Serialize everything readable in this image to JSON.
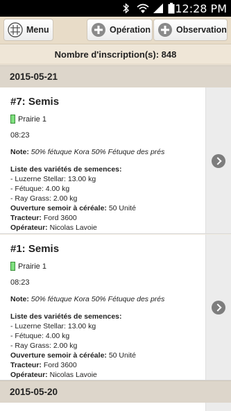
{
  "status_bar": {
    "time": "12:28 PM"
  },
  "toolbar": {
    "menu_label": "Menu",
    "operation_label": "Opération",
    "observation_label": "Observation"
  },
  "summary": {
    "count_text": "Nombre d'inscription(s): 848"
  },
  "groups": [
    {
      "date": "2015-05-21",
      "entries": [
        {
          "title": "#7: Semis",
          "field": "Prairie 1",
          "time": "08:23",
          "note_label": "Note:",
          "note_value": "50% fétuque Kora 50% Fétuque des prés",
          "varieties_label": "Liste des variétés de semences:",
          "varieties": [
            " - Luzerne Stellar: 13.00 kg",
            " - Fétuque: 4.00 kg",
            " - Ray Grass: 2.00 kg"
          ],
          "opening_label": "Ouverture semoir à céréale:",
          "opening_value": "50 Unité",
          "tractor_label": "Tracteur:",
          "tractor_value": "Ford 3600",
          "operator_label": "Opérateur:",
          "operator_value": "Nicolas Lavoie"
        },
        {
          "title": "#1: Semis",
          "field": "Prairie 1",
          "time": "08:23",
          "note_label": "Note:",
          "note_value": "50% fétuque Kora 50% Fétuque des prés",
          "varieties_label": "Liste des variétés de semences:",
          "varieties": [
            " - Luzerne Stellar: 13.00 kg",
            " - Fétuque: 4.00 kg",
            " - Ray Grass: 2.00 kg"
          ],
          "opening_label": "Ouverture semoir à céréale:",
          "opening_value": "50 Unité",
          "tractor_label": "Tracteur:",
          "tractor_value": "Ford 3600",
          "operator_label": "Opérateur:",
          "operator_value": "Nicolas Lavoie"
        }
      ]
    },
    {
      "date": "2015-05-20",
      "entries": []
    }
  ],
  "colors": {
    "toolbar_bg": "#e8dcc8",
    "date_header_bg": "#ddd6cb",
    "field_swatch": "#7fe07f"
  },
  "icons": [
    "bluetooth-icon",
    "wifi-icon",
    "signal-icon",
    "battery-icon",
    "grid-menu-icon",
    "plus-circle-icon",
    "chevron-right-icon"
  ]
}
